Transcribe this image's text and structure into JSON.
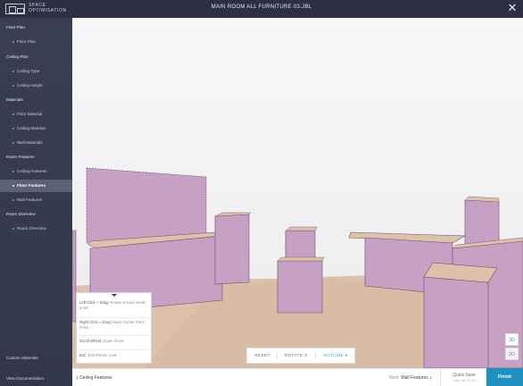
{
  "app": {
    "logo_text": "SPACE\nOPTIMISATION",
    "title": "MAIN ROOM ALL FURNITURE 03.JBL"
  },
  "sidebar": {
    "items": [
      {
        "label": "Floor Plan",
        "type": "section"
      },
      {
        "label": "Floor Plan",
        "type": "sub"
      },
      {
        "label": "Ceiling Plan",
        "type": "section"
      },
      {
        "label": "Ceiling Type",
        "type": "sub"
      },
      {
        "label": "Ceiling Height",
        "type": "sub"
      },
      {
        "label": "Materials",
        "type": "section"
      },
      {
        "label": "Floor Material",
        "type": "sub"
      },
      {
        "label": "Ceiling Material",
        "type": "sub"
      },
      {
        "label": "Wall Materials",
        "type": "sub"
      },
      {
        "label": "Room Features",
        "type": "section"
      },
      {
        "label": "Ceiling Features",
        "type": "sub"
      },
      {
        "label": "Floor Features",
        "type": "sub",
        "active": true
      },
      {
        "label": "Wall Features",
        "type": "sub"
      },
      {
        "label": "Room Overview",
        "type": "section"
      },
      {
        "label": "Room Overview",
        "type": "sub"
      }
    ],
    "custom_materials": "Custom Materials",
    "view_documentation": "View Documentation"
  },
  "help_panel": {
    "rows": [
      {
        "key": "Left Click + Drag:",
        "desc": "Rotate around center point"
      },
      {
        "key": "Right Click + Drag:",
        "desc": "Move Center Point (Pan)"
      },
      {
        "key": "Scroll Wheel:",
        "desc": "Zoom in/out"
      },
      {
        "key": "Esc:",
        "desc": "Exit Pointer Lock"
      }
    ]
  },
  "view_controls": {
    "reset": "RESET",
    "rotate": "ROTATE",
    "outline": "OUTLINE",
    "active": "outline"
  },
  "dimension_toggle": {
    "three_d": "3D",
    "two_d": "2D",
    "active": "3D"
  },
  "bottom_bar": {
    "prev_label": "Ceiling Features",
    "next_prefix": "Next:",
    "next_label": "Wall Features",
    "quick_save": "Quick Save",
    "last_saved": "Last: 4th 12:04",
    "finish": "Finish"
  },
  "colors": {
    "accent": "#2a9fd8",
    "furniture": "#c7a1c3",
    "floor": "#dcc2ad",
    "sidebar": "#3a3e52"
  }
}
